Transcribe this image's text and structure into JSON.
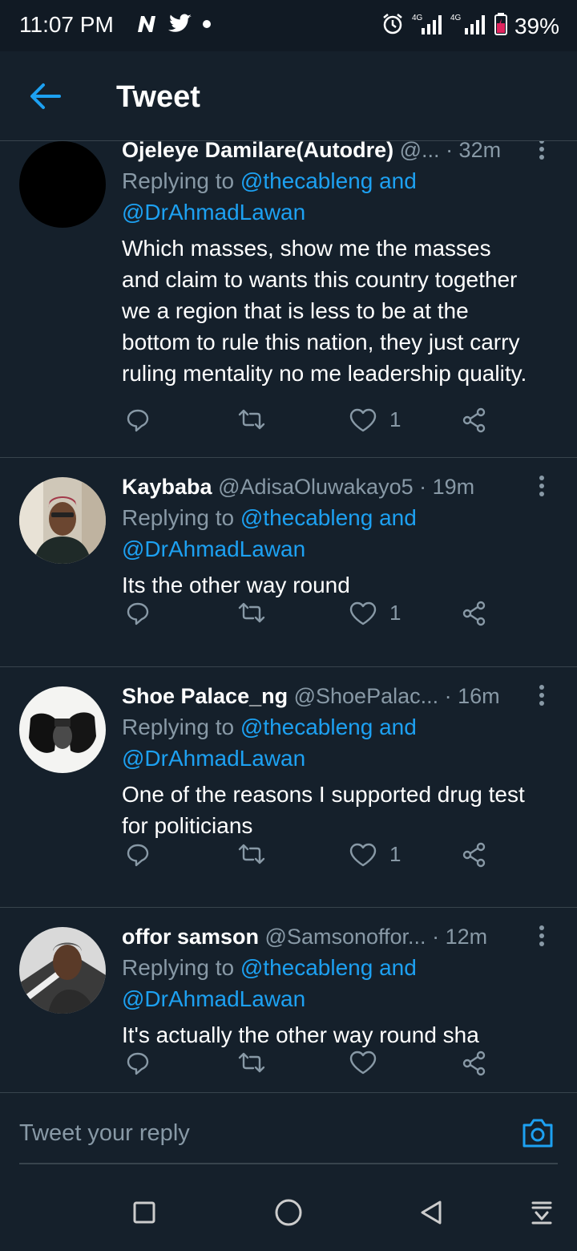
{
  "status_bar": {
    "time": "11:07 PM",
    "battery": "39%",
    "network_1": "4G",
    "network_2": "4G"
  },
  "header": {
    "title": "Tweet"
  },
  "tweets": [
    {
      "name": "Ojeleye Damilare(Autodre)",
      "handle": "@...",
      "time": "· 32m",
      "replying_prefix": "Replying to",
      "mention_1": "@thecableng and",
      "mention_2": "@DrAhmadLawan",
      "text_lines": [
        "Which masses, show me the masses",
        "and claim to wants this country together",
        "we a region that is less to be at the",
        "bottom to rule this nation, they just carry",
        "ruling mentality no me leadership quality."
      ],
      "likes": "1"
    },
    {
      "name": "Kaybaba",
      "handle": "@AdisaOluwakayo5",
      "time": "· 19m",
      "replying_prefix": "Replying to",
      "mention_1": "@thecableng and",
      "mention_2": "@DrAhmadLawan",
      "text_lines": [
        "Its the other way round"
      ],
      "likes": "1"
    },
    {
      "name": "Shoe Palace_ng",
      "handle": "@ShoePalac...",
      "time": "· 16m",
      "replying_prefix": "Replying to",
      "mention_1": "@thecableng and",
      "mention_2": "@DrAhmadLawan",
      "text_lines": [
        "One of the reasons I supported drug test",
        "for politicians"
      ],
      "likes": "1"
    },
    {
      "name": "offor samson",
      "handle": "@Samsonoffor...",
      "time": "· 12m",
      "replying_prefix": "Replying to",
      "mention_1": "@thecableng and",
      "mention_2": "@DrAhmadLawan",
      "text_lines": [
        "It's actually the other way round sha"
      ],
      "likes": ""
    }
  ],
  "composer": {
    "placeholder": "Tweet your reply"
  },
  "colors": {
    "background": "#15202b",
    "accent": "#1da1f2",
    "muted": "#8899a6",
    "divider": "#38444d",
    "battery": "#e0245e"
  }
}
